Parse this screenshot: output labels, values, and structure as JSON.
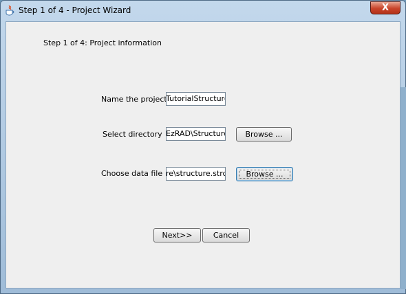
{
  "window": {
    "title": "Step 1 of 4 - Project Wizard",
    "close_label": "X"
  },
  "wizard": {
    "step_heading": "Step 1 of 4: Project information",
    "project_name_label": "Name the project",
    "project_name_value": "TutorialStructure",
    "directory_label": "Select directory",
    "directory_value": "EzRAD\\Structure",
    "data_file_label": "Choose data file",
    "data_file_value": "re\\structure.strc",
    "browse_directory_label": "Browse ...",
    "browse_file_label": "Browse ...",
    "next_label": "Next>>",
    "cancel_label": "Cancel"
  }
}
